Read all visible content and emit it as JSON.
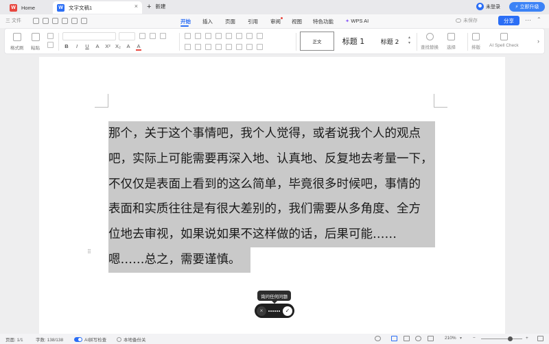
{
  "tabs": {
    "home_label": "Home",
    "doc_label": "文字文稿1",
    "close_glyph": "×",
    "new_label": "新建"
  },
  "account": {
    "login_label": "未登录",
    "upgrade_label": "立即升级"
  },
  "menubar": {
    "file_label": "三 文件",
    "items": [
      "开始",
      "插入",
      "页面",
      "引用",
      "审阅",
      "视图",
      "特色功能",
      "WPS AI"
    ],
    "active": "开始",
    "unsaved_label": "未保存",
    "share_label": "分享"
  },
  "ribbon": {
    "format_painter": "格式刷",
    "paste": "粘贴",
    "format_row": [
      "B",
      "I",
      "U",
      "A",
      "X²",
      "X₂",
      "A",
      "A"
    ],
    "styles": {
      "normal": "正文",
      "heading1": "标题  1",
      "heading2": "标题  2"
    },
    "find_replace": "查找替换",
    "select": "选择",
    "layout": "排版",
    "ai_spell": "AI Spell Check"
  },
  "document": {
    "lines": [
      "那个，关于这个事情吧，我个人觉得，或者说我个人的观点",
      "吧，实际上可能需要再深入地、认真地、反复地去考量一下，",
      "不仅仅是表面上看到的这么简单，毕竟很多时候吧，事情的",
      "表面和实质往往是有很大差别的，我们需要从多角度、全方",
      "位地去审视，如果说如果不这样做的话，后果可能……",
      "嗯……总之，需要谨慎。"
    ]
  },
  "ai_popup": {
    "tooltip": "询问任何问题",
    "cancel_glyph": "×",
    "confirm_glyph": "✓"
  },
  "statusbar": {
    "page": "页面: 1/1",
    "words": "字数: 138/138",
    "spellcheck": "AI拼写检查",
    "backup": "本地备份关",
    "zoom": "210%",
    "zoom_minus": "−",
    "zoom_plus": "+"
  },
  "colors": {
    "accent": "#2b6ef5",
    "selection": "#c9c9c9",
    "wps_red": "#e8473f"
  }
}
